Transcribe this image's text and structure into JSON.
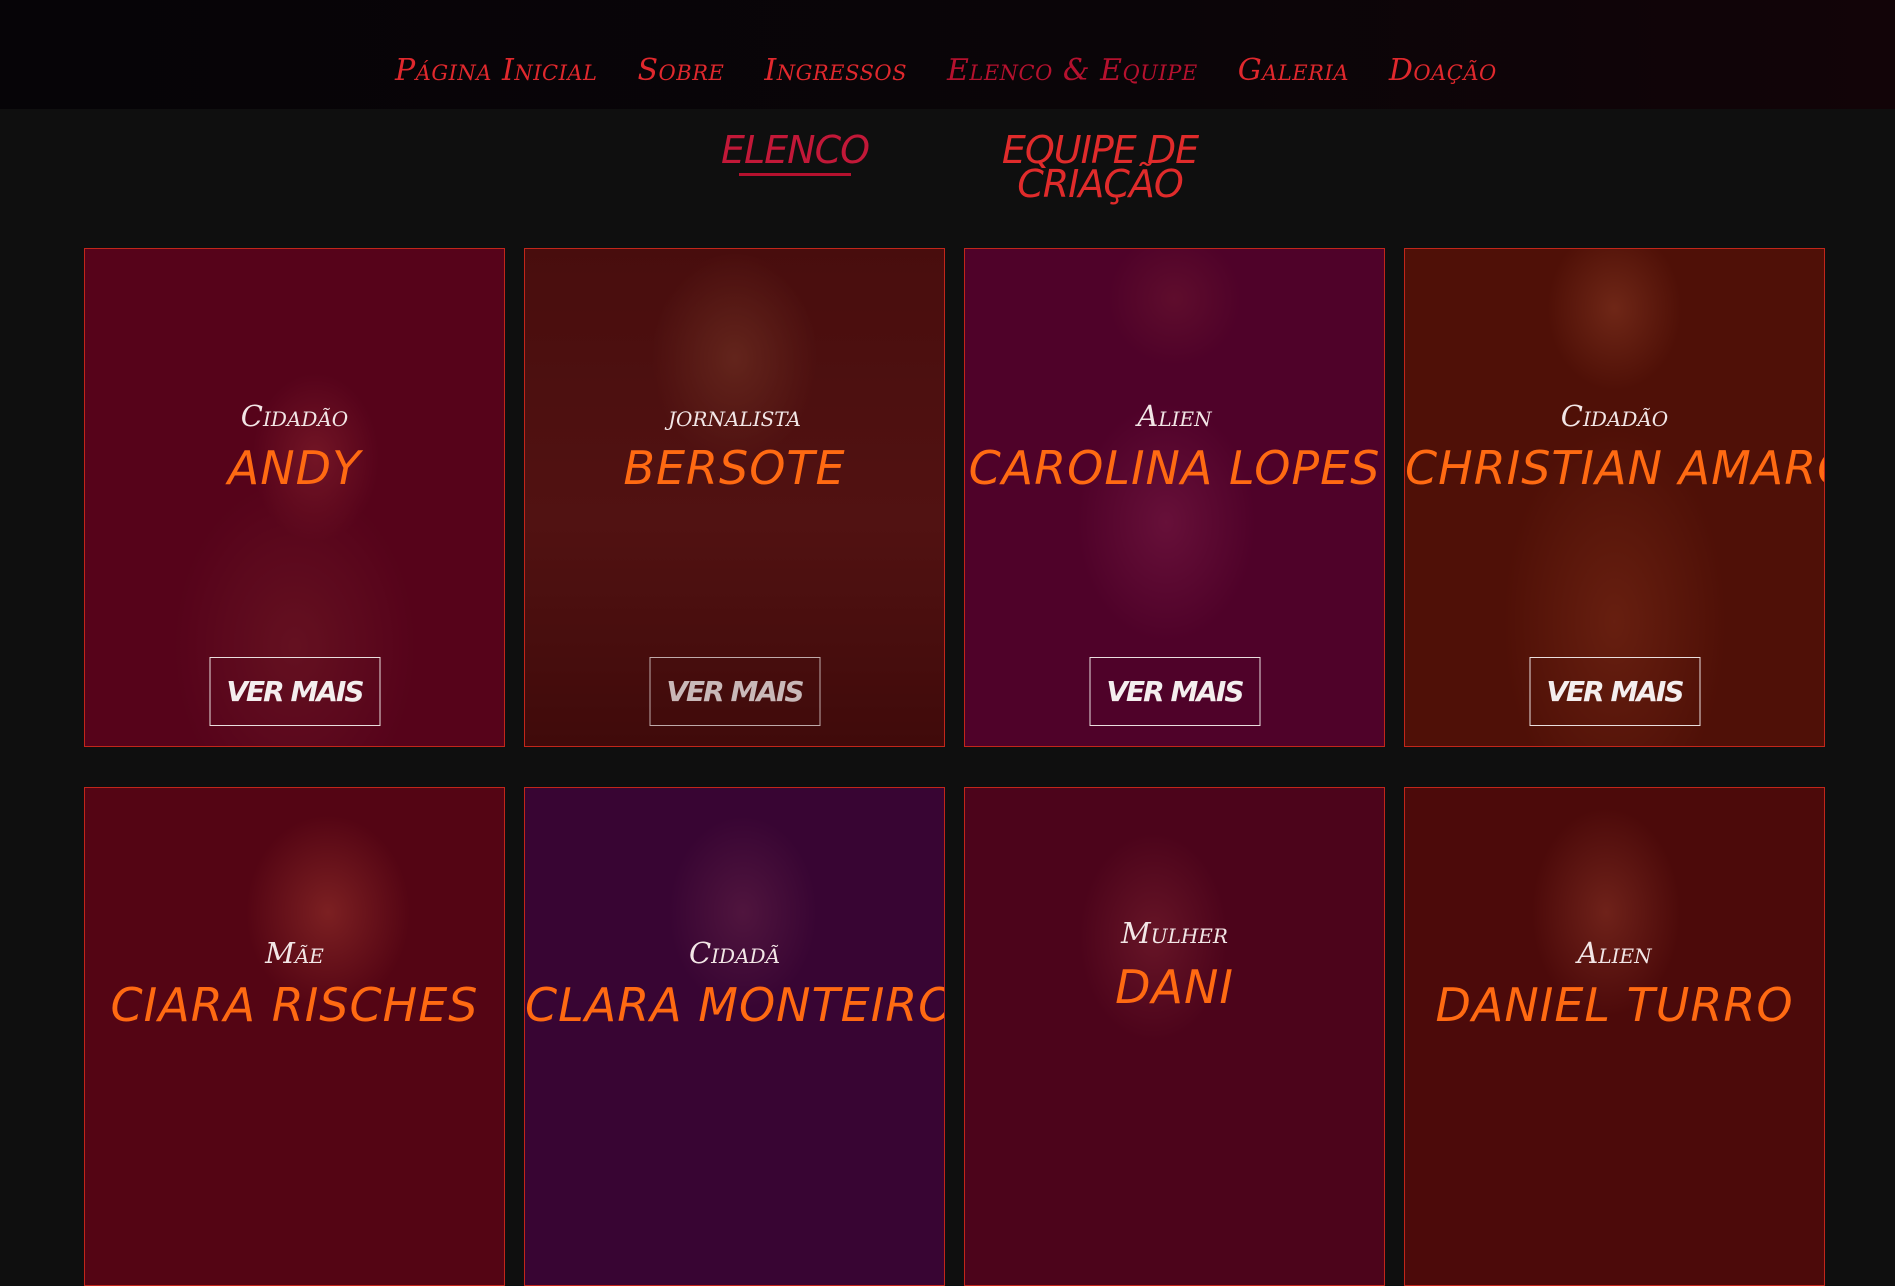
{
  "nav": {
    "items": [
      {
        "label": "Página Inicial"
      },
      {
        "label": "Sobre"
      },
      {
        "label": "Ingressos"
      },
      {
        "label": "Elenco & Equipe"
      },
      {
        "label": "Galeria"
      },
      {
        "label": "Doação"
      }
    ],
    "active_index": 3
  },
  "tabs": {
    "elenco": "ELENCO",
    "equipe": "EQUIPE DE CRIAÇÃO"
  },
  "cards": [
    {
      "role": "Cidadão",
      "name": "ANDY",
      "button": "VER MAIS"
    },
    {
      "role": "jornalista",
      "name": "BERSOTE",
      "button": "VER MAIS"
    },
    {
      "role": "Alien",
      "name": "CAROLINA LOPES",
      "button": "VER MAIS"
    },
    {
      "role": "Cidadão",
      "name": "CHRISTIAN AMARO",
      "button": "VER MAIS"
    },
    {
      "role": "Mãe",
      "name": "CIARA RISCHES"
    },
    {
      "role": "Cidadã",
      "name": "CLARA MONTEIRO"
    },
    {
      "role": "Mulher",
      "name": "DANI"
    },
    {
      "role": "Alien",
      "name": "DANIEL TURRO"
    }
  ],
  "colors": {
    "nav_text": "#e0282d",
    "accent": "#b5112e",
    "name_orange": "#ff6a12",
    "card_border": "#c2261a",
    "background": "#0f0f0f"
  }
}
